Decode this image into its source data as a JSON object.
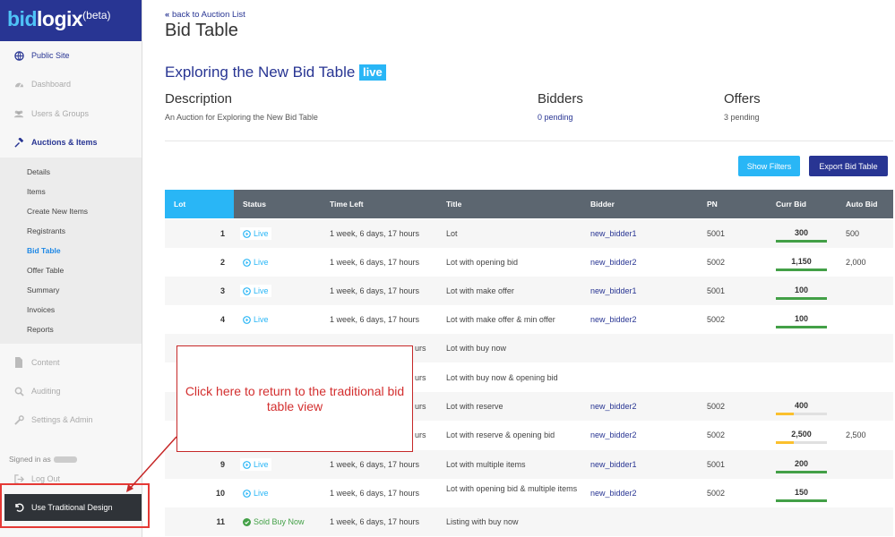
{
  "brand": {
    "part1": "bid",
    "part2": "logix",
    "suffix": "(beta)"
  },
  "sidebar": {
    "items": [
      {
        "label": "Public Site",
        "icon": "globe-icon"
      },
      {
        "label": "Dashboard",
        "icon": "dashboard-icon"
      },
      {
        "label": "Users & Groups",
        "icon": "users-icon"
      },
      {
        "label": "Auctions & Items",
        "icon": "gavel-icon"
      },
      {
        "label": "Content",
        "icon": "document-icon"
      },
      {
        "label": "Auditing",
        "icon": "search-icon"
      },
      {
        "label": "Settings & Admin",
        "icon": "wrench-icon"
      },
      {
        "label": "Log Out",
        "icon": "logout-icon"
      }
    ],
    "submenu": [
      "Details",
      "Items",
      "Create New Items",
      "Registrants",
      "Bid Table",
      "Offer Table",
      "Summary",
      "Invoices",
      "Reports"
    ],
    "active_submenu": "Bid Table",
    "signed_in": "Signed in as",
    "traditional_button": "Use Traditional Design"
  },
  "header": {
    "back_label": "back to Auction List",
    "page_title": "Bid Table"
  },
  "auction": {
    "title": "Exploring the New Bid Table",
    "badge": "live",
    "description_heading": "Description",
    "description": "An Auction for Exploring the New Bid Table",
    "bidders_heading": "Bidders",
    "bidders_value": "0 pending",
    "offers_heading": "Offers",
    "offers_value": "3 pending"
  },
  "toolbar": {
    "show_filters": "Show Filters",
    "export": "Export Bid Table"
  },
  "table": {
    "columns": [
      "Lot",
      "Status",
      "Time Left",
      "Title",
      "Bidder",
      "PN",
      "Curr Bid",
      "Auto Bid"
    ],
    "rows": [
      {
        "lot": "1",
        "status": "Live",
        "time": "1 week, 6 days, 17 hours",
        "title": "Lot",
        "bidder": "new_bidder1",
        "pn": "5001",
        "bid": "300",
        "bar_color": "#43a047",
        "bar_fill": 1.0,
        "auto": "500"
      },
      {
        "lot": "2",
        "status": "Live",
        "time": "1 week, 6 days, 17 hours",
        "title": "Lot with opening bid",
        "bidder": "new_bidder2",
        "pn": "5002",
        "bid": "1,150",
        "bar_color": "#43a047",
        "bar_fill": 1.0,
        "auto": "2,000"
      },
      {
        "lot": "3",
        "status": "Live",
        "time": "1 week, 6 days, 17 hours",
        "title": "Lot with make offer",
        "bidder": "new_bidder1",
        "pn": "5001",
        "bid": "100",
        "bar_color": "#43a047",
        "bar_fill": 1.0,
        "auto": ""
      },
      {
        "lot": "4",
        "status": "Live",
        "time": "1 week, 6 days, 17 hours",
        "title": "Lot with make offer & min offer",
        "bidder": "new_bidder2",
        "pn": "5002",
        "bid": "100",
        "bar_color": "#43a047",
        "bar_fill": 1.0,
        "auto": ""
      },
      {
        "lot": "",
        "status": "",
        "time": "urs",
        "title": "Lot with buy now",
        "bidder": "",
        "pn": "",
        "bid": "",
        "bar_color": "",
        "bar_fill": 0,
        "auto": ""
      },
      {
        "lot": "",
        "status": "",
        "time": "urs",
        "title": "Lot with buy now & opening bid",
        "bidder": "",
        "pn": "",
        "bid": "",
        "bar_color": "",
        "bar_fill": 0,
        "auto": ""
      },
      {
        "lot": "",
        "status": "",
        "time": "urs",
        "title": "Lot with reserve",
        "bidder": "new_bidder2",
        "pn": "5002",
        "bid": "400",
        "bar_color": "#fbc02d",
        "bar_fill": 0.35,
        "auto": ""
      },
      {
        "lot": "",
        "status": "",
        "time": "urs",
        "title": "Lot with reserve & opening bid",
        "bidder": "new_bidder2",
        "pn": "5002",
        "bid": "2,500",
        "bar_color": "#fbc02d",
        "bar_fill": 0.35,
        "auto": "2,500"
      },
      {
        "lot": "9",
        "status": "Live",
        "time": "1 week, 6 days, 17 hours",
        "title": "Lot with multiple items",
        "bidder": "new_bidder1",
        "pn": "5001",
        "bid": "200",
        "bar_color": "#43a047",
        "bar_fill": 1.0,
        "auto": ""
      },
      {
        "lot": "10",
        "status": "Live",
        "time": "1 week, 6 days, 17 hours",
        "title": "Lot with opening bid & multiple items",
        "bidder": "new_bidder2",
        "pn": "5002",
        "bid": "150",
        "bar_color": "#43a047",
        "bar_fill": 1.0,
        "auto": ""
      },
      {
        "lot": "11",
        "status": "Sold Buy Now",
        "time": "1 week, 6 days, 17 hours",
        "title": "Listing with buy now",
        "bidder": "",
        "pn": "",
        "bid": "",
        "bar_color": "",
        "bar_fill": 0,
        "auto": ""
      }
    ]
  },
  "callout": {
    "text": "Click here to return to the traditional bid table view"
  },
  "colors": {
    "brand": "#283593",
    "accent": "#29b6f6",
    "live": "#29b6f6",
    "sold": "#43a047",
    "callout": "#d32f2f"
  }
}
